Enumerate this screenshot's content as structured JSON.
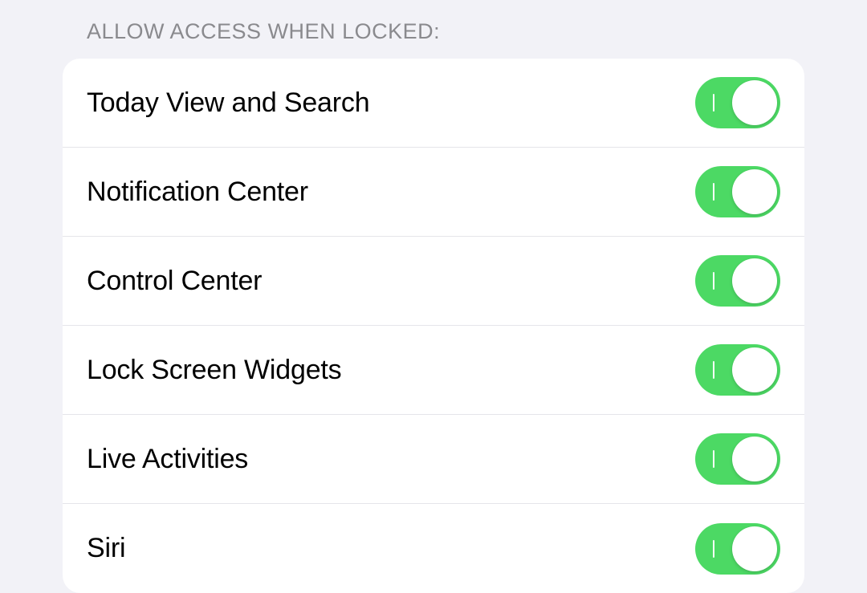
{
  "section": {
    "header": "Allow Access When Locked:"
  },
  "rows": [
    {
      "id": "today-view",
      "label": "Today View and Search",
      "on": true
    },
    {
      "id": "notification-center",
      "label": "Notification Center",
      "on": true
    },
    {
      "id": "control-center",
      "label": "Control Center",
      "on": true
    },
    {
      "id": "lock-screen-widgets",
      "label": "Lock Screen Widgets",
      "on": true
    },
    {
      "id": "live-activities",
      "label": "Live Activities",
      "on": true
    },
    {
      "id": "siri",
      "label": "Siri",
      "on": true
    }
  ],
  "colors": {
    "toggle_on": "#4cd964",
    "background": "#f2f2f7",
    "group_bg": "#ffffff",
    "divider": "#e5e5ea",
    "header_text": "#8a8a8e"
  }
}
